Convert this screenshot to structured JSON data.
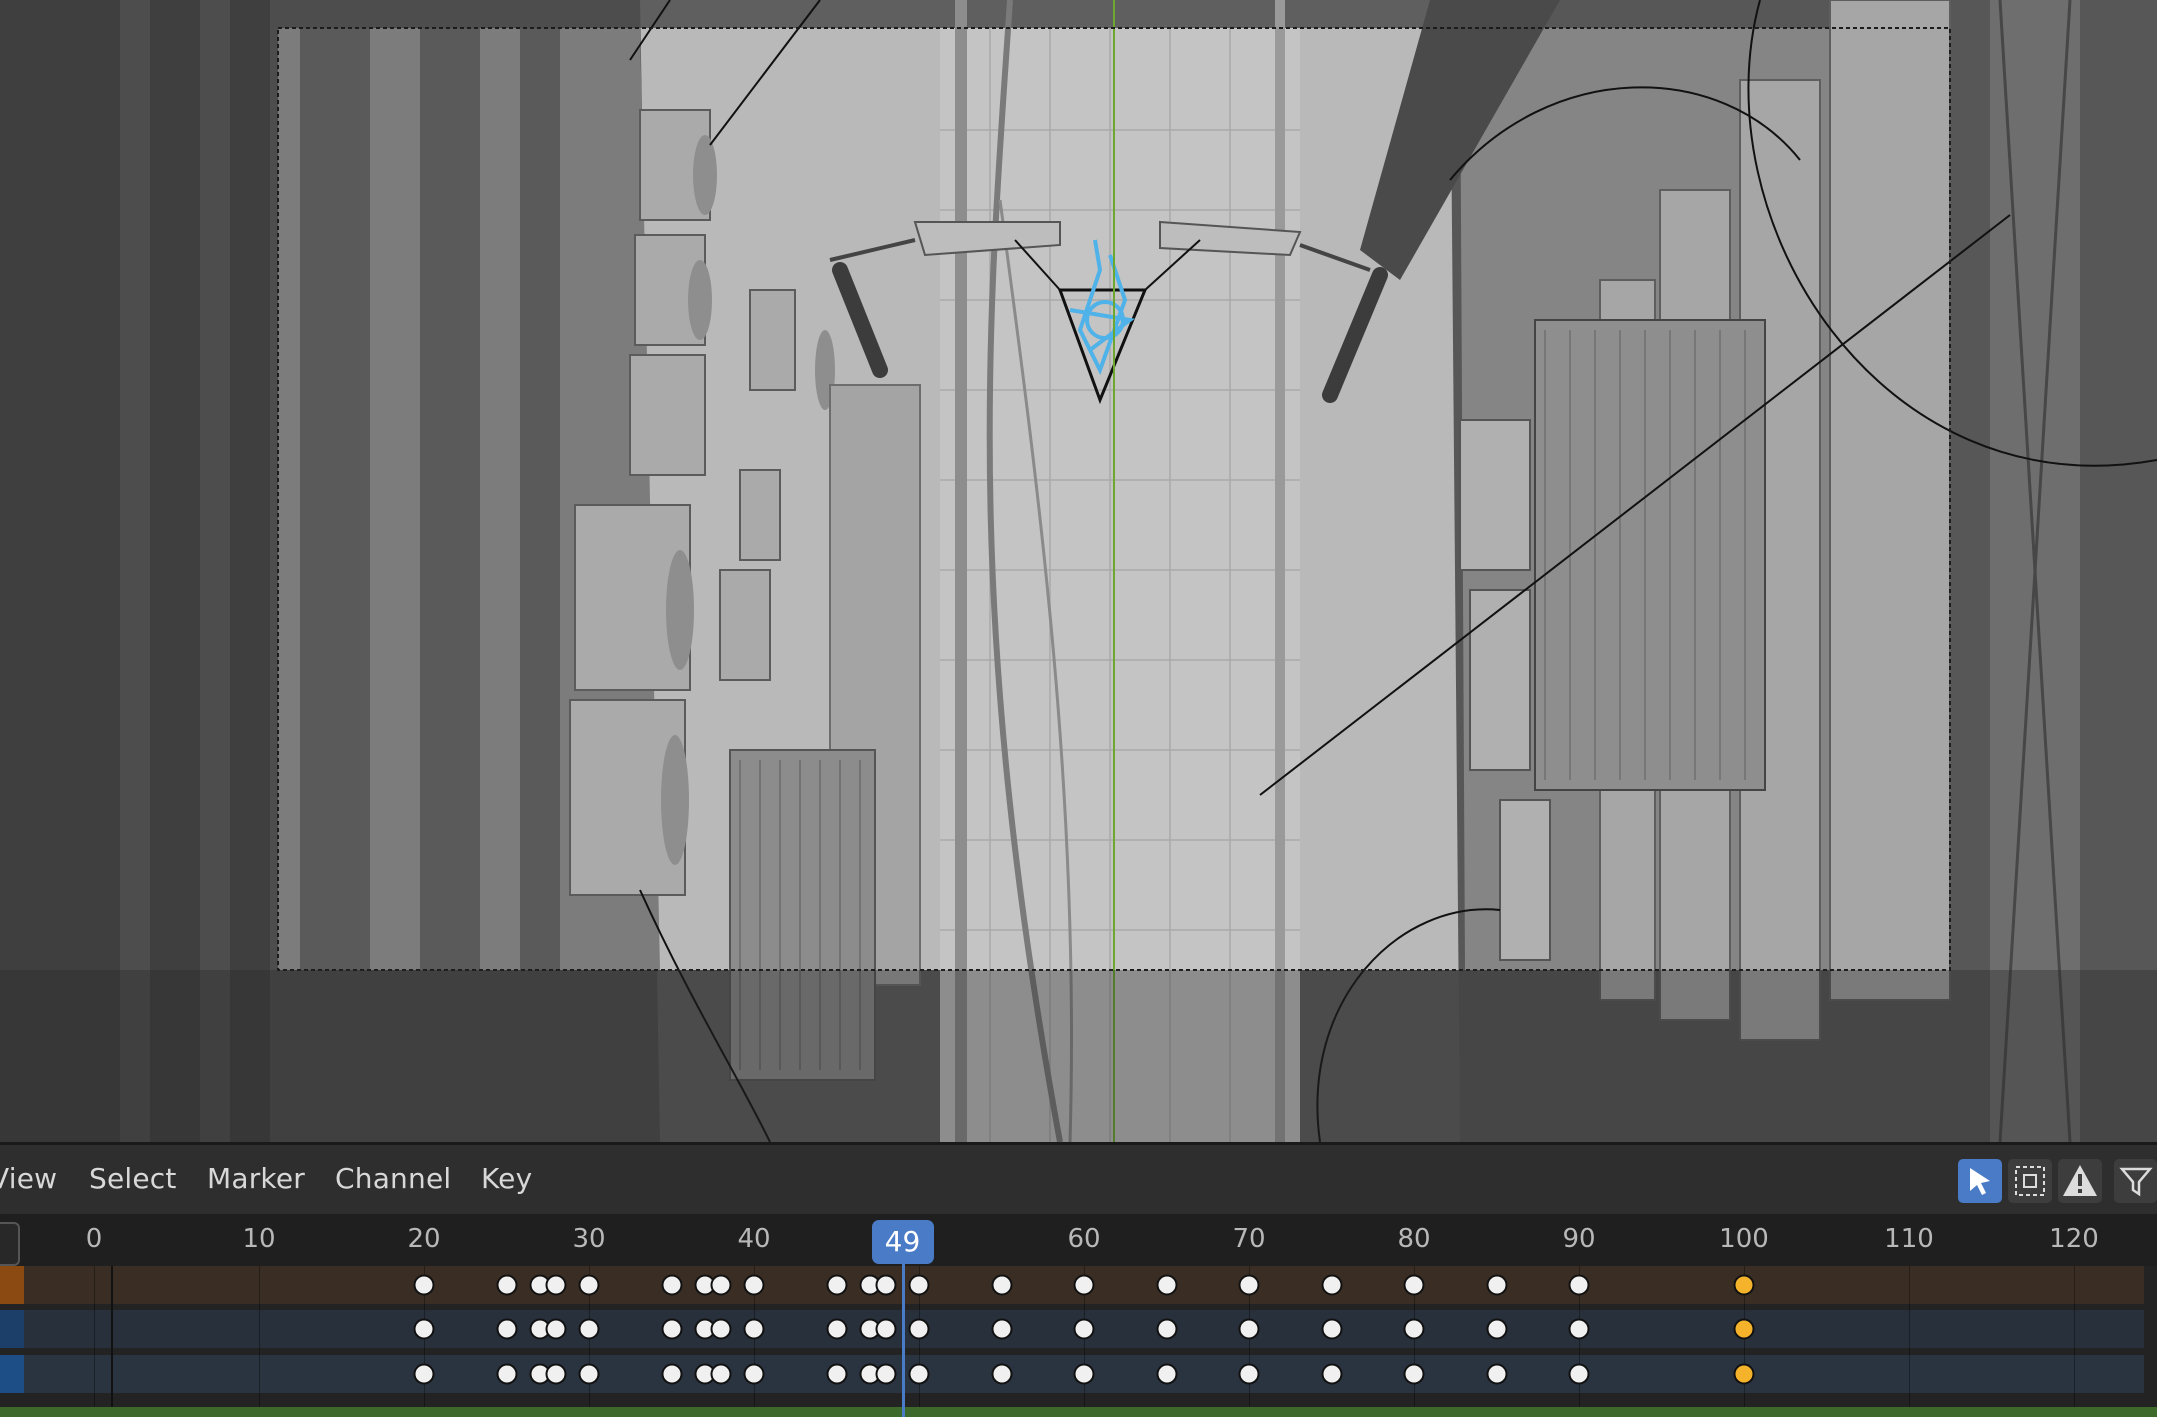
{
  "menu": {
    "view": "View",
    "select": "Select",
    "marker": "Marker",
    "channel": "Channel",
    "key": "Key"
  },
  "toolbar_icons": [
    "select-cursor-icon",
    "box-select-icon",
    "warning-icon",
    "filter-icon"
  ],
  "ruler": {
    "ticks": [
      "0",
      "10",
      "20",
      "30",
      "40",
      "50",
      "60",
      "70",
      "80",
      "90",
      "100",
      "110",
      "120"
    ],
    "current_frame": "49"
  },
  "keyframes": {
    "frames": [
      20,
      25,
      27,
      28,
      30,
      35,
      37,
      38,
      40,
      45,
      47,
      48,
      50,
      55,
      60,
      65,
      70,
      75,
      80,
      85,
      90,
      100
    ],
    "selected_frame": 100
  },
  "colors": {
    "accent": "#4a7bc6",
    "selected_keyframe": "#f5b32c",
    "track_summary": "#3a2e24",
    "track_object": "#28303c",
    "tab_orange": "#8a4a12",
    "tab_blue": "#1c3f6a",
    "tab_green": "#3d6a2a"
  }
}
